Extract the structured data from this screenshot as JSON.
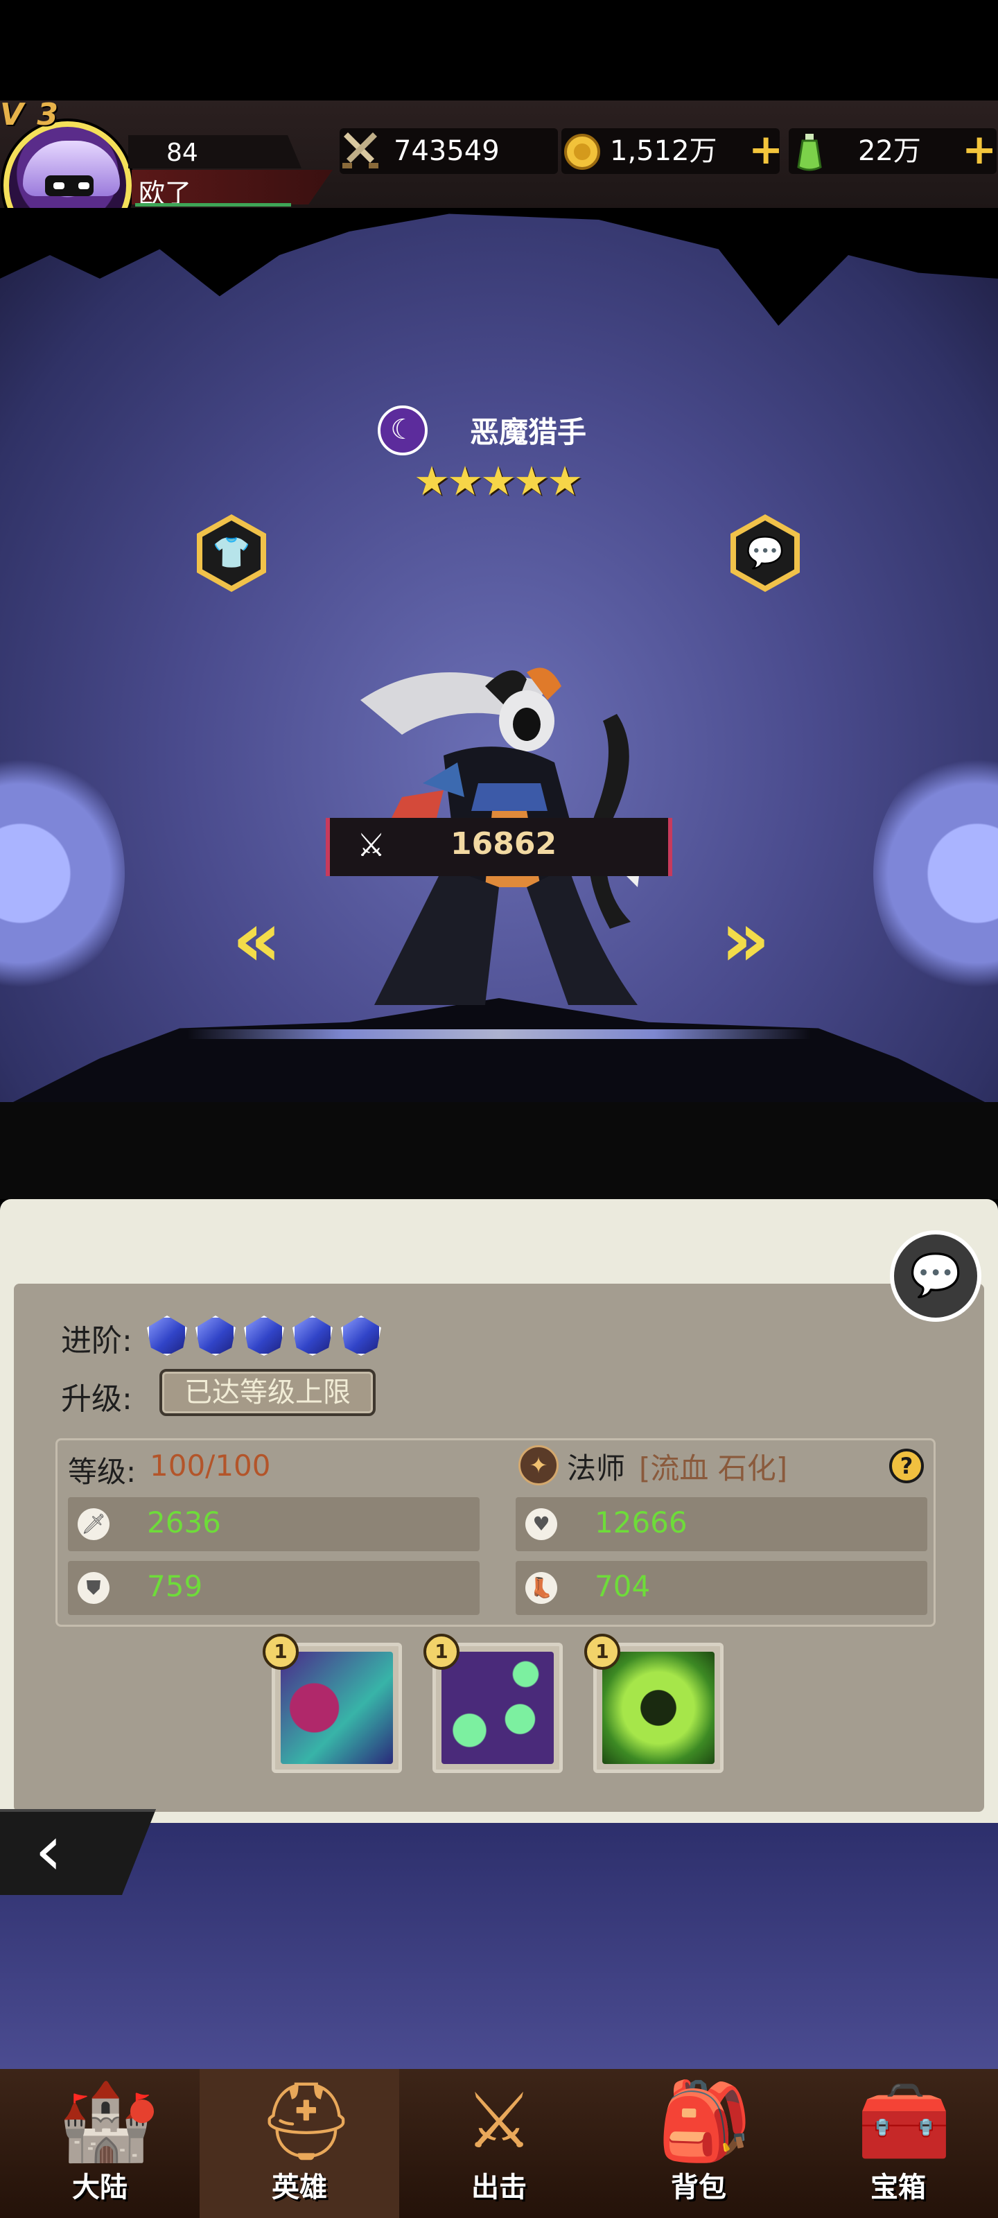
{
  "player": {
    "vip_label": "V 3",
    "level": "84",
    "name": "欧了"
  },
  "resources": {
    "power": "743549",
    "gold": "1,512万",
    "potion": "22万"
  },
  "hero": {
    "name": "恶魔猎手",
    "stars": "★★★★★",
    "combat_power": "16862"
  },
  "panel": {
    "advance_label": "进阶:",
    "upgrade_label": "升级:",
    "upgrade_button": "已达等级上限",
    "level_label": "等级:",
    "level_value": "100/100",
    "class_name": "法师",
    "class_tags": "[流血 石化]",
    "stats": {
      "attack": "2636",
      "health": "12666",
      "defense": "759",
      "speed": "704"
    },
    "skills": [
      {
        "level": "1"
      },
      {
        "level": "1"
      },
      {
        "level": "1"
      }
    ]
  },
  "nav": {
    "items": [
      {
        "label": "大陆"
      },
      {
        "label": "英雄"
      },
      {
        "label": "出击"
      },
      {
        "label": "背包"
      },
      {
        "label": "宝箱"
      }
    ]
  },
  "colors": {
    "accent_gold": "#f3c53c",
    "stat_green": "#6edc3a",
    "level_orange": "#b3552a"
  }
}
